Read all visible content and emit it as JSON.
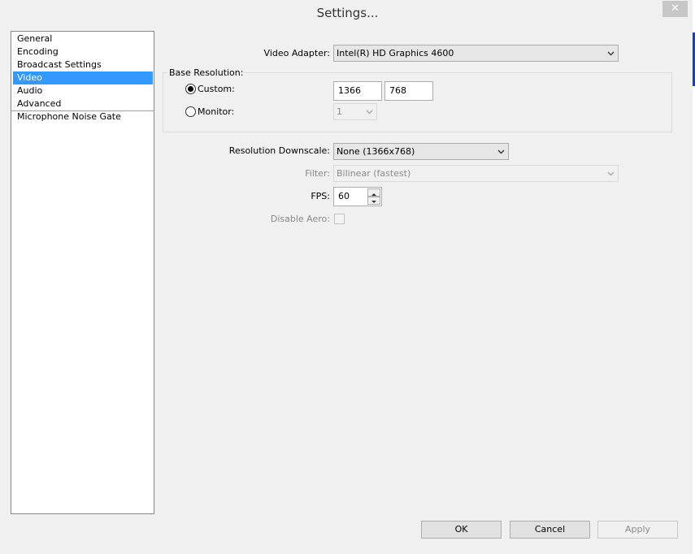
{
  "window": {
    "title": "Settings...",
    "close_symbol": "✕"
  },
  "sidebar": {
    "items": [
      {
        "label": "General"
      },
      {
        "label": "Encoding"
      },
      {
        "label": "Broadcast Settings"
      },
      {
        "label": "Video",
        "selected": true
      },
      {
        "label": "Audio"
      },
      {
        "label": "Advanced"
      },
      {
        "label": "Microphone Noise Gate"
      }
    ]
  },
  "video": {
    "adapter_label": "Video Adapter:",
    "adapter_value": "Intel(R) HD Graphics 4600",
    "base_resolution_label": "Base Resolution:",
    "custom_label": "Custom:",
    "custom_selected": true,
    "custom_width": "1366",
    "custom_height": "768",
    "monitor_label": "Monitor:",
    "monitor_value": "1",
    "downscale_label": "Resolution Downscale:",
    "downscale_value": "None  (1366x768)",
    "filter_label": "Filter:",
    "filter_value": "Bilinear (fastest)",
    "fps_label": "FPS:",
    "fps_value": "60",
    "disable_aero_label": "Disable Aero:",
    "disable_aero_checked": false
  },
  "buttons": {
    "ok": "OK",
    "cancel": "Cancel",
    "apply": "Apply"
  },
  "icons": {
    "close": "close-icon",
    "dropdown": "chevron-down-icon",
    "spin_up": "spin-up-icon",
    "spin_down": "spin-down-icon"
  },
  "colors": {
    "selection": "#3399ff",
    "window_bg": "#f0f0f0"
  }
}
